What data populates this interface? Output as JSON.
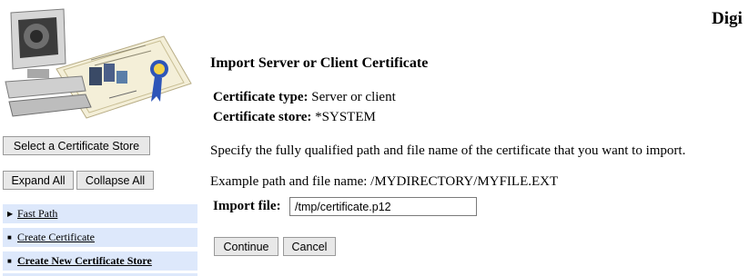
{
  "header": {
    "app_title": "Digi"
  },
  "sidebar": {
    "select_store_label": "Select a Certificate Store",
    "expand_all_label": "Expand All",
    "collapse_all_label": "Collapse All",
    "items": [
      {
        "label": "Fast Path",
        "bullet": "▶"
      },
      {
        "label": "Create Certificate",
        "bullet": "■"
      },
      {
        "label": "Create New Certificate Store",
        "bullet": "■"
      }
    ]
  },
  "main": {
    "heading": "Import Server or Client Certificate",
    "cert_type_label": "Certificate type:",
    "cert_type_value": "Server or client",
    "cert_store_label": "Certificate store:",
    "cert_store_value": "*SYSTEM",
    "instructions": "Specify the fully qualified path and file name of the certificate that you want to import.",
    "example": "Example path and file name: /MYDIRECTORY/MYFILE.EXT",
    "import_file_label": "Import file:",
    "import_file_value": "/tmp/certificate.p12",
    "continue_label": "Continue",
    "cancel_label": "Cancel"
  },
  "colors": {
    "nav_bg": "#dde8fb",
    "logo_band": "#e6effa"
  }
}
